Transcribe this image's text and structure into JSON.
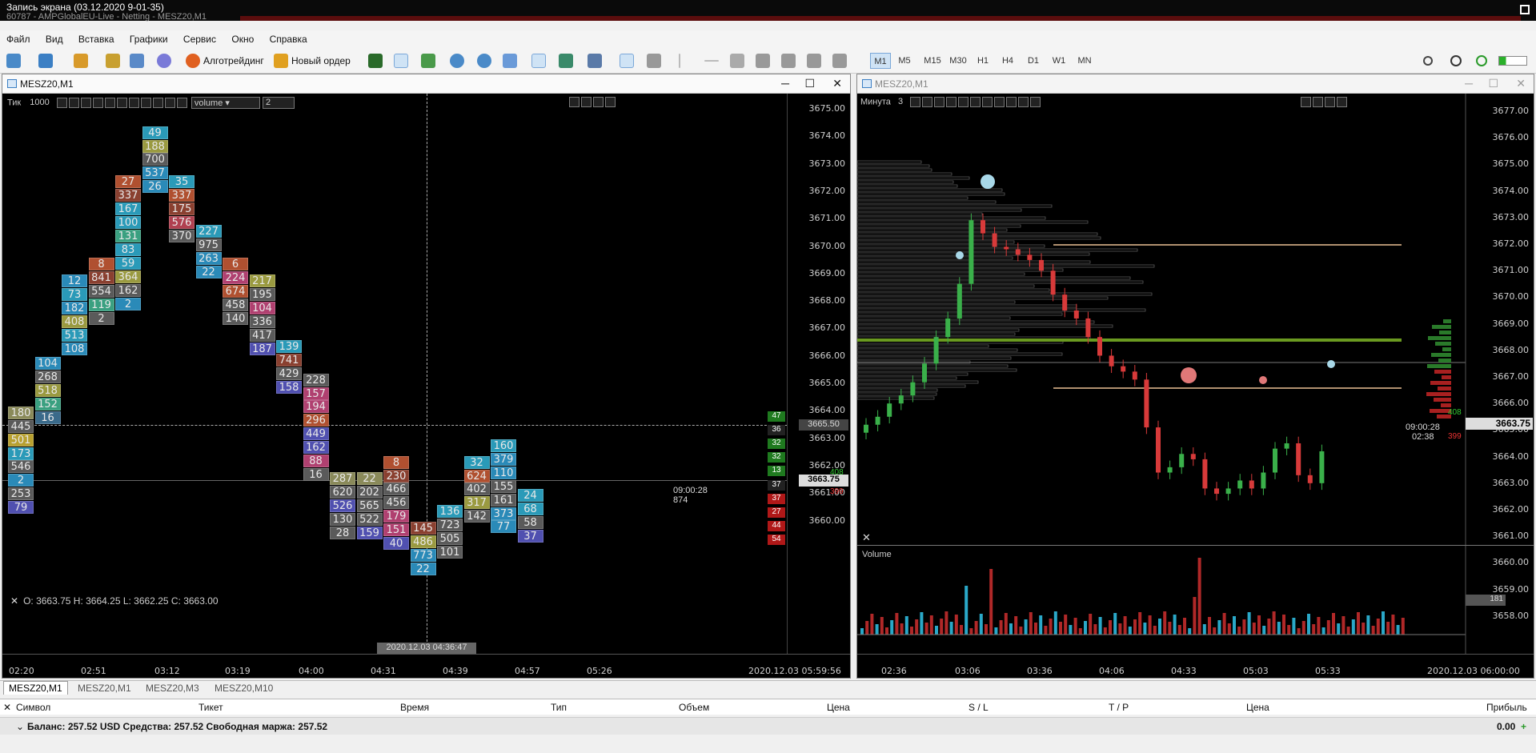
{
  "titlebar": {
    "line1": "Запись экрана (03.12.2020 9-01-35)",
    "line2": "60787 - AMPGlobalEU-Live - Netting - MESZ20,M1"
  },
  "menu": [
    "Файл",
    "Вид",
    "Вставка",
    "Графики",
    "Сервис",
    "Окно",
    "Справка"
  ],
  "toolbar": {
    "algo_label": "Алготрейдинг",
    "order_label": "Новый ордер",
    "timeframes": [
      "M1",
      "M5",
      "M15",
      "M30",
      "H1",
      "H4",
      "D1",
      "W1",
      "MN"
    ],
    "active_timeframe": "M1"
  },
  "left_window": {
    "title": "MESZ20,M1",
    "panel_label": "Тик",
    "panel_value": "1000",
    "dropdown": "volume",
    "spin_value": "2",
    "ohlc": "O: 3663.75  H: 3664.25  L: 3662.25  C: 3663.00",
    "cursor_time": "2020.12.03 04:36:47",
    "last_time": "2020.12.03 05:59:56",
    "timer": "09:00:28",
    "timer_sub": "874",
    "crosshair_price": "3665.50",
    "current_price": "3663.75",
    "price_labels": [
      "3675.00",
      "3674.00",
      "3673.00",
      "3672.00",
      "3671.00",
      "3670.00",
      "3669.00",
      "3668.00",
      "3667.00",
      "3666.00",
      "3665.00",
      "3664.00",
      "3663.00",
      "3662.00",
      "3661.00",
      "3660.00"
    ],
    "time_labels": [
      "02:20",
      "02:51",
      "03:12",
      "03:19",
      "04:00",
      "04:31",
      "04:39",
      "04:57",
      "05:26"
    ],
    "side_values": [
      {
        "v": "47",
        "color": "#1f7a1f"
      },
      {
        "v": "36",
        "color": "#222"
      },
      {
        "v": "32",
        "color": "#1f7a1f"
      },
      {
        "v": "32",
        "color": "#1f7a1f"
      },
      {
        "v": "13",
        "color": "#1f7a1f"
      },
      {
        "v": "37",
        "color": "#222"
      },
      {
        "v": "37",
        "color": "#b01818"
      },
      {
        "v": "27",
        "color": "#b01818"
      },
      {
        "v": "44",
        "color": "#b01818"
      },
      {
        "v": "54",
        "color": "#b01818"
      }
    ],
    "side_bid": "408",
    "side_ask": "399",
    "footprint": [
      {
        "col": 0,
        "cells": [
          [
            "180",
            "#8a8a5a"
          ],
          [
            "445",
            "#5a5a5a"
          ],
          [
            "501",
            "#b8a030"
          ],
          [
            "173",
            "#2a9ab8"
          ],
          [
            "546",
            "#5a5a5a"
          ],
          [
            "2",
            "#2a8ab8"
          ],
          [
            "253",
            "#5a5a5a"
          ],
          [
            "79",
            "#5050b0"
          ]
        ],
        "start": 3666.0
      },
      {
        "col": 1,
        "cells": [
          [
            "104",
            "#2a8ab8"
          ],
          [
            "268",
            "#5a5a5a"
          ],
          [
            "518",
            "#9a9a40"
          ],
          [
            "152",
            "#3aa080"
          ],
          [
            "16",
            "#3a6a8a"
          ]
        ],
        "start": 3667.5
      },
      {
        "col": 2,
        "cells": [
          [
            "12",
            "#2a8ab8"
          ],
          [
            "73",
            "#2a9ab8"
          ],
          [
            "182",
            "#2a8ab8"
          ],
          [
            "408",
            "#9a9a40"
          ],
          [
            "513",
            "#2a9ab8"
          ],
          [
            "108",
            "#2a8ab8"
          ]
        ],
        "start": 3670.0
      },
      {
        "col": 3,
        "cells": [
          [
            "8",
            "#b05030"
          ],
          [
            "841",
            "#8a4030"
          ],
          [
            "554",
            "#5a5a5a"
          ],
          [
            "119",
            "#3aa080"
          ],
          [
            "2",
            "#5a5a5a"
          ]
        ],
        "start": 3670.5
      },
      {
        "col": 4,
        "cells": [
          [
            "27",
            "#b05030"
          ],
          [
            "337",
            "#8a4030"
          ],
          [
            "167",
            "#2a9ab8"
          ],
          [
            "100",
            "#2a9ab8"
          ],
          [
            "131",
            "#3aa080"
          ],
          [
            "83",
            "#2a9ab8"
          ],
          [
            "59",
            "#2a9ab8"
          ],
          [
            "364",
            "#9a9a40"
          ],
          [
            "162",
            "#5a5a5a"
          ],
          [
            "2",
            "#2a8ab8"
          ]
        ],
        "start": 3673.0
      },
      {
        "col": 5,
        "cells": [
          [
            "49",
            "#2a9ab8"
          ],
          [
            "188",
            "#9a9a40"
          ],
          [
            "700",
            "#5a5a5a"
          ],
          [
            "537",
            "#2a8ab8"
          ],
          [
            "26",
            "#2a8ab8"
          ]
        ],
        "start": 3674.5
      },
      {
        "col": 6,
        "cells": [
          [
            "35",
            "#2a9ab8"
          ],
          [
            "337",
            "#b05030"
          ],
          [
            "175",
            "#8a4030"
          ],
          [
            "576",
            "#b04050"
          ],
          [
            "370",
            "#5a5a5a"
          ]
        ],
        "start": 3673.0
      },
      {
        "col": 7,
        "cells": [
          [
            "227",
            "#2a9ab8"
          ],
          [
            "975",
            "#5a5a5a"
          ],
          [
            "263",
            "#2a8ab8"
          ],
          [
            "22",
            "#2a8ab8"
          ]
        ],
        "start": 3671.5
      },
      {
        "col": 8,
        "cells": [
          [
            "6",
            "#b05030"
          ],
          [
            "224",
            "#b04070"
          ],
          [
            "674",
            "#b05030"
          ],
          [
            "458",
            "#5a5a5a"
          ],
          [
            "140",
            "#5a5a5a"
          ]
        ],
        "start": 3670.5
      },
      {
        "col": 9,
        "cells": [
          [
            "217",
            "#9a9a40"
          ],
          [
            "195",
            "#5a5a5a"
          ],
          [
            "104",
            "#b04070"
          ],
          [
            "336",
            "#5a5a5a"
          ],
          [
            "417",
            "#5a5a5a"
          ],
          [
            "187",
            "#5050b0"
          ]
        ],
        "start": 3670.0
      },
      {
        "col": 10,
        "cells": [
          [
            "139",
            "#2a9ab8"
          ],
          [
            "741",
            "#8a4030"
          ],
          [
            "429",
            "#5a5a5a"
          ],
          [
            "158",
            "#5050b0"
          ]
        ],
        "start": 3668.0
      },
      {
        "col": 11,
        "cells": [
          [
            "228",
            "#5a5a5a"
          ],
          [
            "157",
            "#b04070"
          ],
          [
            "194",
            "#b04070"
          ],
          [
            "296",
            "#b05030"
          ],
          [
            "449",
            "#5050b0"
          ],
          [
            "162",
            "#5050b0"
          ],
          [
            "88",
            "#b04070"
          ],
          [
            "16",
            "#5a5a5a"
          ]
        ],
        "start": 3667.0
      },
      {
        "col": 12,
        "cells": [
          [
            "287",
            "#8a8a5a"
          ],
          [
            "620",
            "#5a5a5a"
          ],
          [
            "526",
            "#5050b0"
          ],
          [
            "130",
            "#5a5a5a"
          ],
          [
            "28",
            "#5a5a5a"
          ]
        ],
        "start": 3664.0
      },
      {
        "col": 13,
        "cells": [
          [
            "22",
            "#8a8a5a"
          ],
          [
            "202",
            "#5a5a5a"
          ],
          [
            "565",
            "#5a5a5a"
          ],
          [
            "522",
            "#5a5a5a"
          ],
          [
            "159",
            "#5050b0"
          ]
        ],
        "start": 3664.0
      },
      {
        "col": 14,
        "cells": [
          [
            "8",
            "#b05030"
          ],
          [
            "230",
            "#8a4030"
          ],
          [
            "466",
            "#5a5a5a"
          ],
          [
            "456",
            "#5a5a5a"
          ],
          [
            "179",
            "#b04070"
          ],
          [
            "151",
            "#b04070"
          ],
          [
            "40",
            "#5050b0"
          ]
        ],
        "start": 3664.5
      },
      {
        "col": 15,
        "cells": [
          [
            "145",
            "#8a4030"
          ],
          [
            "486",
            "#9a9a40"
          ],
          [
            "773",
            "#2a8ab8"
          ],
          [
            "22",
            "#2a8ab8"
          ]
        ],
        "start": 3662.5
      },
      {
        "col": 16,
        "cells": [
          [
            "136",
            "#2a9ab8"
          ],
          [
            "723",
            "#5a5a5a"
          ],
          [
            "505",
            "#5a5a5a"
          ],
          [
            "101",
            "#5a5a5a"
          ]
        ],
        "start": 3663.0
      },
      {
        "col": 17,
        "cells": [
          [
            "32",
            "#2a9ab8"
          ],
          [
            "624",
            "#b05030"
          ],
          [
            "402",
            "#5a5a5a"
          ],
          [
            "317",
            "#9a9a40"
          ],
          [
            "142",
            "#5a5a5a"
          ]
        ],
        "start": 3664.5
      },
      {
        "col": 18,
        "cells": [
          [
            "160",
            "#2a9ab8"
          ],
          [
            "379",
            "#2a8ab8"
          ],
          [
            "110",
            "#2a8ab8"
          ],
          [
            "155",
            "#5a5a5a"
          ],
          [
            "161",
            "#5a5a5a"
          ],
          [
            "373",
            "#2a8ab8"
          ],
          [
            "77",
            "#2a8ab8"
          ]
        ],
        "start": 3665.0
      },
      {
        "col": 19,
        "cells": [
          [
            "24",
            "#2a9ab8"
          ],
          [
            "68",
            "#2a9ab8"
          ],
          [
            "58",
            "#5a5a5a"
          ],
          [
            "37",
            "#5050b0"
          ]
        ],
        "start": 3663.5
      }
    ]
  },
  "right_window": {
    "title": "MESZ20,M1",
    "panel_label": "Минута",
    "panel_value": "3",
    "price_labels": [
      "3677.00",
      "3676.00",
      "3675.00",
      "3674.00",
      "3673.00",
      "3672.00",
      "3671.00",
      "3670.00",
      "3669.00",
      "3668.00",
      "3667.00",
      "3666.00",
      "3665.00",
      "3664.00",
      "3663.00",
      "3662.00",
      "3661.00",
      "3660.00",
      "3659.00",
      "3658.00"
    ],
    "time_labels": [
      "02:36",
      "03:06",
      "03:36",
      "04:06",
      "04:33",
      "05:03",
      "05:33"
    ],
    "last_time": "2020.12.03 06:00:00",
    "current_price": "3663.75",
    "timer": "09:00:28",
    "timer_sub": "02:38",
    "bid": "408",
    "ask": "399",
    "volume_label": "Volume",
    "volume_value": "181"
  },
  "tabs": [
    "MESZ20,M1",
    "MESZ20,M1",
    "MESZ20,M3",
    "MESZ20,M10"
  ],
  "terminal": {
    "cols": [
      "Символ",
      "Тикет",
      "Время",
      "Тип",
      "Объем",
      "Цена",
      "S / L",
      "T / P",
      "Цена",
      "Прибыль"
    ],
    "balance_row": "Баланс: 257.52 USD  Средства: 257.52  Свободная маржа: 257.52",
    "profit": "0.00"
  }
}
